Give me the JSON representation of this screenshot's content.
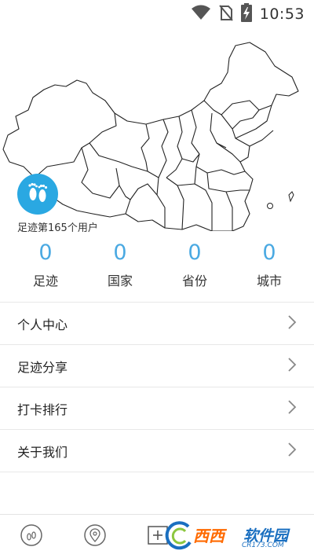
{
  "status_bar": {
    "time": "10:53",
    "icons": [
      "wifi-icon",
      "no-sim-icon",
      "battery-charging-icon"
    ]
  },
  "profile": {
    "avatar_icon": "footprints-icon",
    "rank_text": "足迹第165个用户"
  },
  "stats": [
    {
      "value": "0",
      "label": "足迹"
    },
    {
      "value": "0",
      "label": "国家"
    },
    {
      "value": "0",
      "label": "省份"
    },
    {
      "value": "0",
      "label": "城市"
    }
  ],
  "menu": [
    {
      "label": "个人中心"
    },
    {
      "label": "足迹分享"
    },
    {
      "label": "打卡排行"
    },
    {
      "label": "关于我们"
    }
  ],
  "bottom_nav": {
    "items": [
      "footprint-nav-icon",
      "location-pin-nav-icon",
      "add-nav-icon"
    ]
  },
  "watermark": {
    "brand": "西西",
    "brand2": "软件园",
    "url": "CR173.COM"
  },
  "colors": {
    "accent": "#4aa9e2",
    "avatar_bg": "#2aa8e2",
    "divider": "#e8e8e8"
  }
}
